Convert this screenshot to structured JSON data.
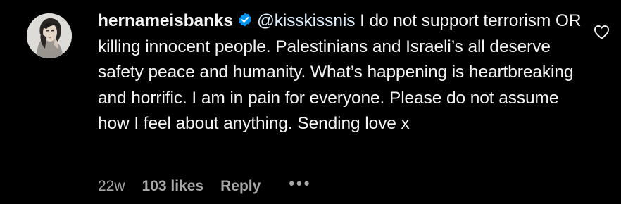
{
  "comment": {
    "author": {
      "username": "hernameisbanks",
      "verified": true,
      "verified_icon": "verified-badge-icon",
      "avatar_icon": "avatar"
    },
    "mention": "@kisskissnis",
    "text": " I do not support terrorism OR killing innocent people. Palestinians and Israeli’s all deserve safety peace and humanity. What’s happening is heartbreaking and horrific. I am in pain for everyone. Please do not assume how I feel about anything. Sending love x",
    "meta": {
      "time": "22w",
      "likes": "103 likes",
      "reply": "Reply",
      "more": "•••"
    },
    "like_icon": "heart-icon"
  },
  "colors": {
    "background": "#000000",
    "text": "#f5f5f5",
    "mention": "#e0f1ff",
    "meta": "#a8a8a8",
    "verified": "#0095f6"
  }
}
